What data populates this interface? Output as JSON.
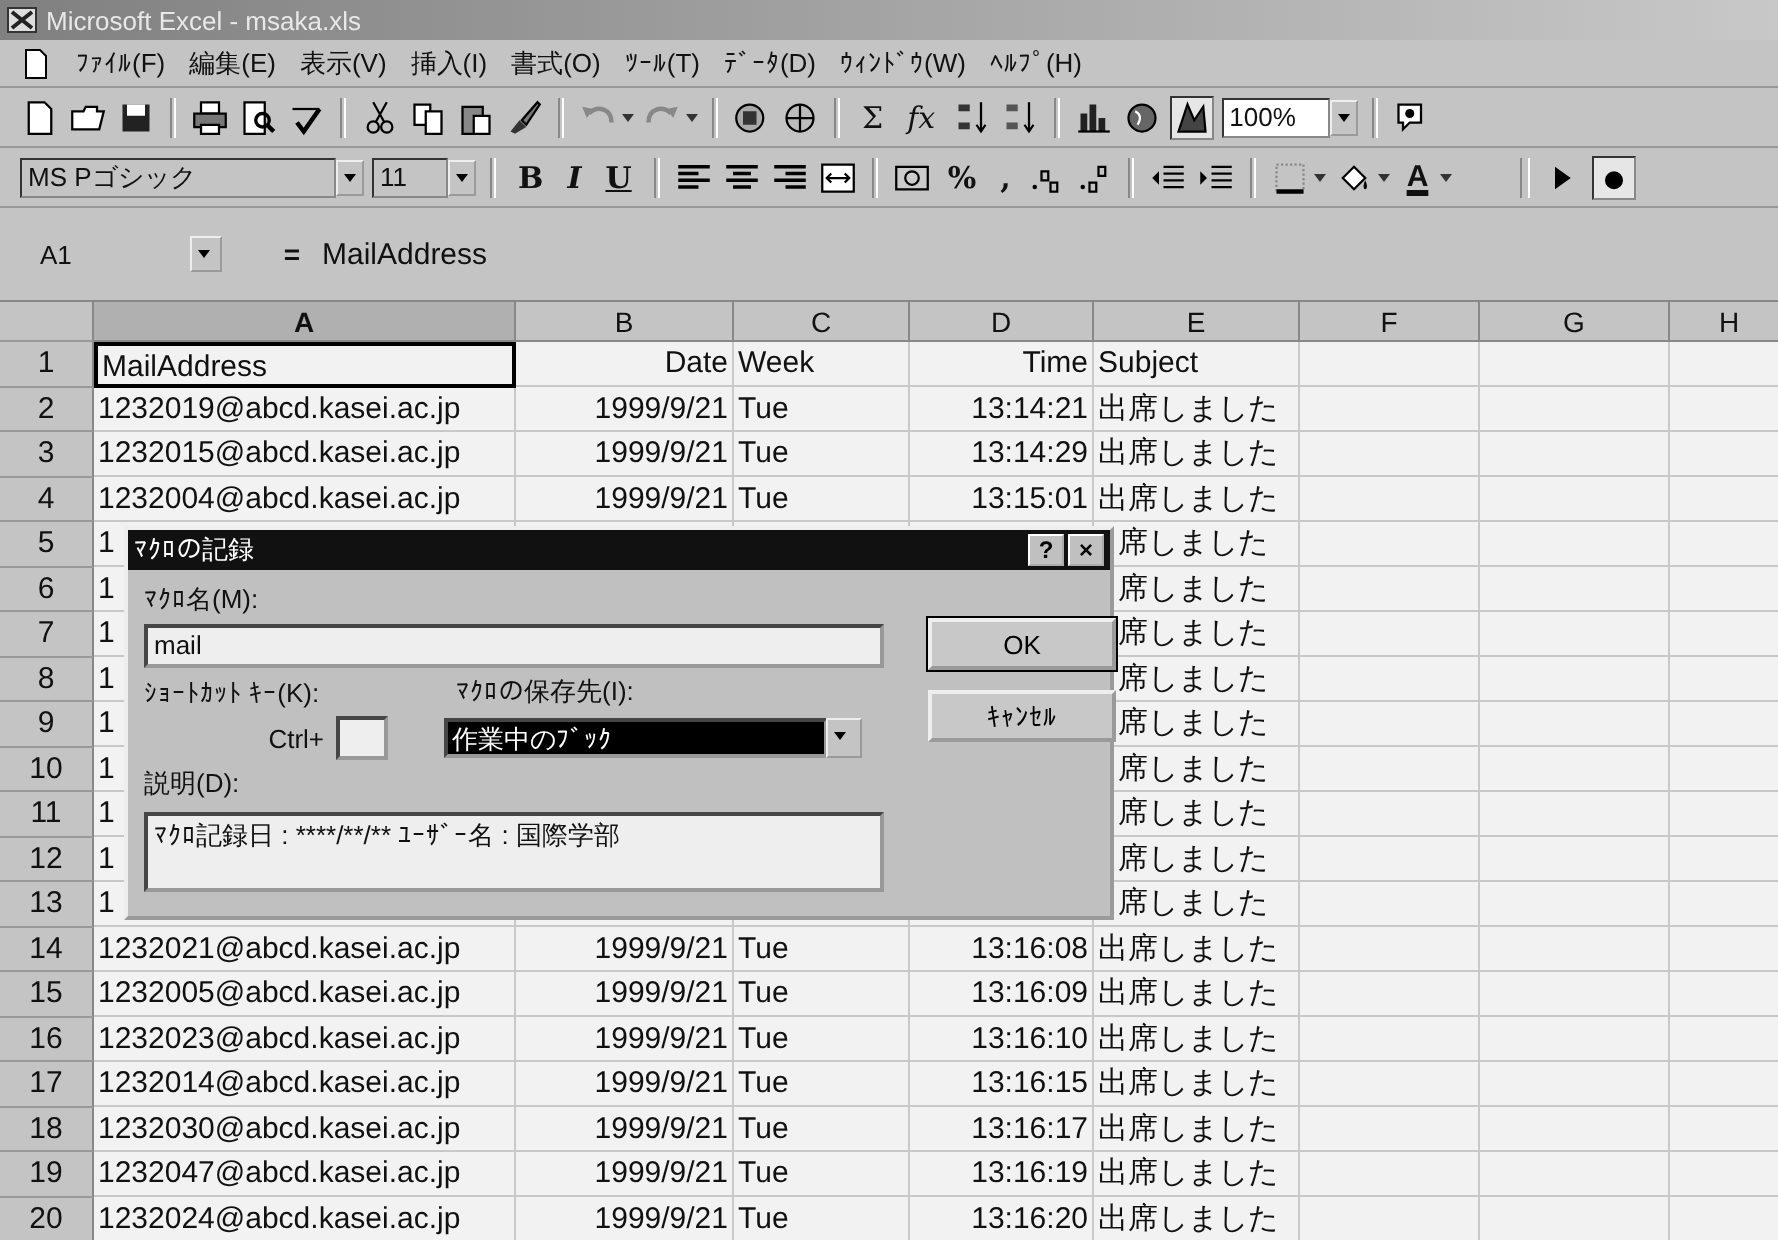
{
  "window": {
    "title": "Microsoft Excel - msaka.xls"
  },
  "menu": [
    "ﾌｧｲﾙ(F)",
    "編集(E)",
    "表示(V)",
    "挿入(I)",
    "書式(O)",
    "ﾂｰﾙ(T)",
    "ﾃﾞｰﾀ(D)",
    "ｳｨﾝﾄﾞｳ(W)",
    "ﾍﾙﾌﾟ(H)"
  ],
  "standard_toolbar": {
    "sum": "Σ",
    "function": "fx",
    "zoom": "100%"
  },
  "formatting_toolbar": {
    "font": "MS Pゴシック",
    "size": "11",
    "bold": "B",
    "italic": "I",
    "underline": "U",
    "percent": "%",
    "comma": ",",
    "font_color": "A"
  },
  "formula_bar": {
    "name_box": "A1",
    "equals": "=",
    "content": "MailAddress"
  },
  "columns": [
    {
      "label": "A",
      "selected": true
    },
    {
      "label": "B",
      "selected": false
    },
    {
      "label": "C",
      "selected": false
    },
    {
      "label": "D",
      "selected": false
    },
    {
      "label": "E",
      "selected": false
    },
    {
      "label": "F",
      "selected": false
    },
    {
      "label": "G",
      "selected": false
    },
    {
      "label": "H",
      "selected": false
    }
  ],
  "rows": [
    {
      "row": "1",
      "covered": false,
      "cells": [
        "MailAddress",
        "Date",
        "Week",
        "Time",
        "Subject"
      ]
    },
    {
      "row": "2",
      "covered": false,
      "cells": [
        "1232019@abcd.kasei.ac.jp",
        "1999/9/21",
        "Tue",
        "13:14:21",
        "出席しました"
      ]
    },
    {
      "row": "3",
      "covered": false,
      "cells": [
        "1232015@abcd.kasei.ac.jp",
        "1999/9/21",
        "Tue",
        "13:14:29",
        "出席しました"
      ]
    },
    {
      "row": "4",
      "covered": false,
      "cells": [
        "1232004@abcd.kasei.ac.jp",
        "1999/9/21",
        "Tue",
        "13:15:01",
        "出席しました"
      ]
    },
    {
      "row": "5",
      "covered": true,
      "cells": [
        "1",
        "席しました"
      ]
    },
    {
      "row": "6",
      "covered": true,
      "cells": [
        "1",
        "席しました"
      ]
    },
    {
      "row": "7",
      "covered": true,
      "cells": [
        "1",
        "席しました"
      ]
    },
    {
      "row": "8",
      "covered": true,
      "cells": [
        "1",
        "席しました"
      ]
    },
    {
      "row": "9",
      "covered": true,
      "cells": [
        "1",
        "席しました"
      ]
    },
    {
      "row": "10",
      "covered": true,
      "cells": [
        "1",
        "席しました"
      ]
    },
    {
      "row": "11",
      "covered": true,
      "cells": [
        "1",
        "席しました"
      ]
    },
    {
      "row": "12",
      "covered": true,
      "cells": [
        "1",
        "席しました"
      ]
    },
    {
      "row": "13",
      "covered": true,
      "cells": [
        "1",
        "席しました"
      ]
    },
    {
      "row": "14",
      "covered": false,
      "cells": [
        "1232021@abcd.kasei.ac.jp",
        "1999/9/21",
        "Tue",
        "13:16:08",
        "出席しました"
      ]
    },
    {
      "row": "15",
      "covered": false,
      "cells": [
        "1232005@abcd.kasei.ac.jp",
        "1999/9/21",
        "Tue",
        "13:16:09",
        "出席しました"
      ]
    },
    {
      "row": "16",
      "covered": false,
      "cells": [
        "1232023@abcd.kasei.ac.jp",
        "1999/9/21",
        "Tue",
        "13:16:10",
        "出席しました"
      ]
    },
    {
      "row": "17",
      "covered": false,
      "cells": [
        "1232014@abcd.kasei.ac.jp",
        "1999/9/21",
        "Tue",
        "13:16:15",
        "出席しました"
      ]
    },
    {
      "row": "18",
      "covered": false,
      "cells": [
        "1232030@abcd.kasei.ac.jp",
        "1999/9/21",
        "Tue",
        "13:16:17",
        "出席しました"
      ]
    },
    {
      "row": "19",
      "covered": false,
      "cells": [
        "1232047@abcd.kasei.ac.jp",
        "1999/9/21",
        "Tue",
        "13:16:19",
        "出席しました"
      ]
    },
    {
      "row": "20",
      "covered": false,
      "cells": [
        "1232024@abcd.kasei.ac.jp",
        "1999/9/21",
        "Tue",
        "13:16:20",
        "出席しました"
      ]
    }
  ],
  "dialog": {
    "title": "ﾏｸﾛの記録",
    "help": "?",
    "close": "×",
    "name_label": "ﾏｸﾛ名(M):",
    "name_value": "mail",
    "shortcut_label": "ｼｮｰﾄｶｯﾄ ｷｰ(K):",
    "ctrl_label": "Ctrl+",
    "store_label": "ﾏｸﾛの保存先(I):",
    "store_value": "作業中のﾌﾞｯｸ",
    "description_label": "説明(D):",
    "description_value": "ﾏｸﾛ記録日 : ****/**/**  ﾕｰｻﾞｰ名 : 国際学部",
    "ok": "OK",
    "cancel": "ｷｬﾝｾﾙ"
  }
}
